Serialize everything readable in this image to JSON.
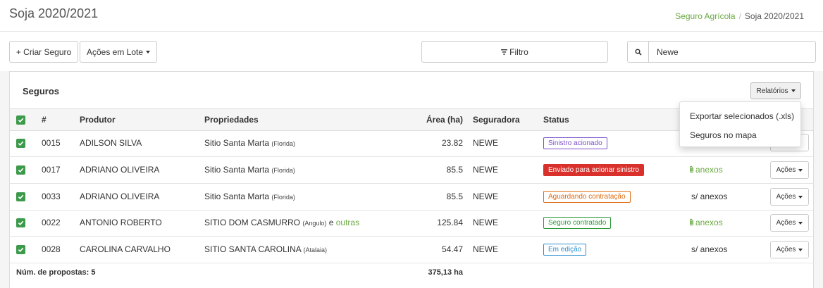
{
  "header": {
    "title": "Soja 2020/2021",
    "breadcrumb": [
      {
        "label": "Seguro Agrícola"
      },
      {
        "label": "Soja 2020/2021"
      }
    ]
  },
  "toolbar": {
    "create_label": "+ Criar Seguro",
    "batch_label": "Ações em Lote",
    "filter_label": "Filtro",
    "search_value": "Newe"
  },
  "panel": {
    "title": "Seguros",
    "reports_label": "Relatórios"
  },
  "reports_menu": {
    "items": [
      "Exportar selecionados (.xls)",
      "Seguros no mapa"
    ]
  },
  "table": {
    "columns": {
      "num": "#",
      "producer": "Produtor",
      "properties": "Propriedades",
      "area": "Área (ha)",
      "insurer": "Seguradora",
      "status": "Status"
    },
    "rows": [
      {
        "checked": true,
        "num": "0015",
        "producer": "ADILSON SILVA",
        "property": "Sitio Santa Marta",
        "locality": "(Florida)",
        "others": "",
        "area": "23.82",
        "insurer": "NEWE",
        "status": "Sinistro acionado",
        "status_color": "#7b4fc9",
        "status_style": "outline",
        "attachments": "",
        "attach_icon": false,
        "actions": ""
      },
      {
        "checked": true,
        "num": "0017",
        "producer": "ADRIANO OLIVEIRA",
        "property": "Sitio Santa Marta",
        "locality": "(Florida)",
        "others": "",
        "area": "85.5",
        "insurer": "NEWE",
        "status": "Enviado para acionar sinistro",
        "status_color": "#d9302b",
        "status_style": "solid",
        "attachments": "anexos",
        "attach_icon": true,
        "actions": "Ações"
      },
      {
        "checked": true,
        "num": "0033",
        "producer": "ADRIANO OLIVEIRA",
        "property": "Sitio Santa Marta",
        "locality": "(Florida)",
        "others": "",
        "area": "85.5",
        "insurer": "NEWE",
        "status": "Aguardando contratação",
        "status_color": "#e06b12",
        "status_style": "outline",
        "attachments": "s/ anexos",
        "attach_icon": false,
        "actions": "Ações"
      },
      {
        "checked": true,
        "num": "0022",
        "producer": "ANTONIO ROBERTO",
        "property": "SITIO DOM CASMURRO",
        "locality": "(Angulo)",
        "others": "outras",
        "area": "125.84",
        "insurer": "NEWE",
        "status": "Seguro contratado",
        "status_color": "#2e9a3a",
        "status_style": "outline",
        "attachments": "anexos",
        "attach_icon": true,
        "actions": "Ações"
      },
      {
        "checked": true,
        "num": "0028",
        "producer": "CAROLINA CARVALHO",
        "property": "SITIO SANTA CAROLINA",
        "locality": "(Atalaia)",
        "others": "",
        "area": "54.47",
        "insurer": "NEWE",
        "status": "Em edição",
        "status_color": "#2a8fd0",
        "status_style": "outline",
        "attachments": "s/ anexos",
        "attach_icon": false,
        "actions": "Ações"
      }
    ],
    "footer": {
      "count_label": "Núm. de propostas: 5",
      "total_area": "375,13 ha"
    }
  },
  "colors": {
    "accent_green": "#6aa842",
    "checkbox_green": "#3c9a4a"
  },
  "icons": {
    "search": "search-icon",
    "filter": "filter-icon",
    "checkbox": "check-icon",
    "attachment": "paperclip-icon"
  }
}
